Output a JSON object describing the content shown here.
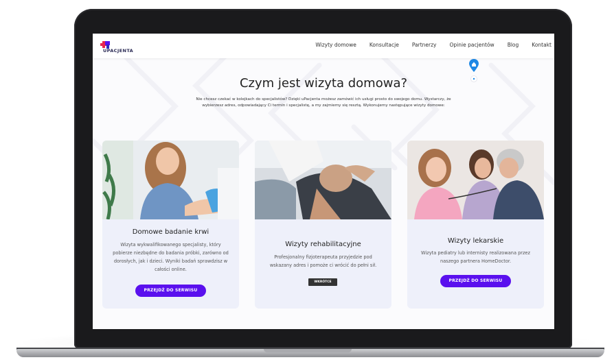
{
  "brand": {
    "name": "UPACJENTA",
    "accent": "#5a10ee"
  },
  "nav": {
    "items": [
      "Wizyty domowe",
      "Konsultacje",
      "Partnerzy",
      "Opinie pacjentów",
      "Blog",
      "Kontakt"
    ]
  },
  "hero": {
    "title": "Czym jest wizyta domowa?",
    "subtitle_line1": "Nie chcesz czekać w kolejkach do specjalistów? Dzięki uPacjenta możesz zamówić ich usługi prosto do swojego domu. Wystarczy, że",
    "subtitle_line2": "wybierzesz adres, odpowiadający Ci termin i specjalistę, a my zajmiemy się resztą. Wykonujemy następujące wizyty domowe:"
  },
  "cards": [
    {
      "title": "Domowe badanie krwi",
      "text": "Wizyta wykwalifikowanego specjalisty, który pobierze niezbędne do badania próbki, zarówno od dorosłych, jak i dzieci. Wyniki badań sprawdzisz w całości online.",
      "button": "PRZEJDŹ DO SERWISU"
    },
    {
      "title": "Wizyty rehabilitacyjne",
      "text": "Profesjonalny fizjoterapeuta przyjedzie pod wskazany adres i pomoże ci wrócić do pełni sił.",
      "badge": "WKRÓTCE"
    },
    {
      "title": "Wizyty lekarskie",
      "text": "Wizyta pediatry lub internisty realizowana przez naszego partnera HomeDoctor.",
      "button": "PRZEJDŹ DO SERWISU"
    }
  ]
}
